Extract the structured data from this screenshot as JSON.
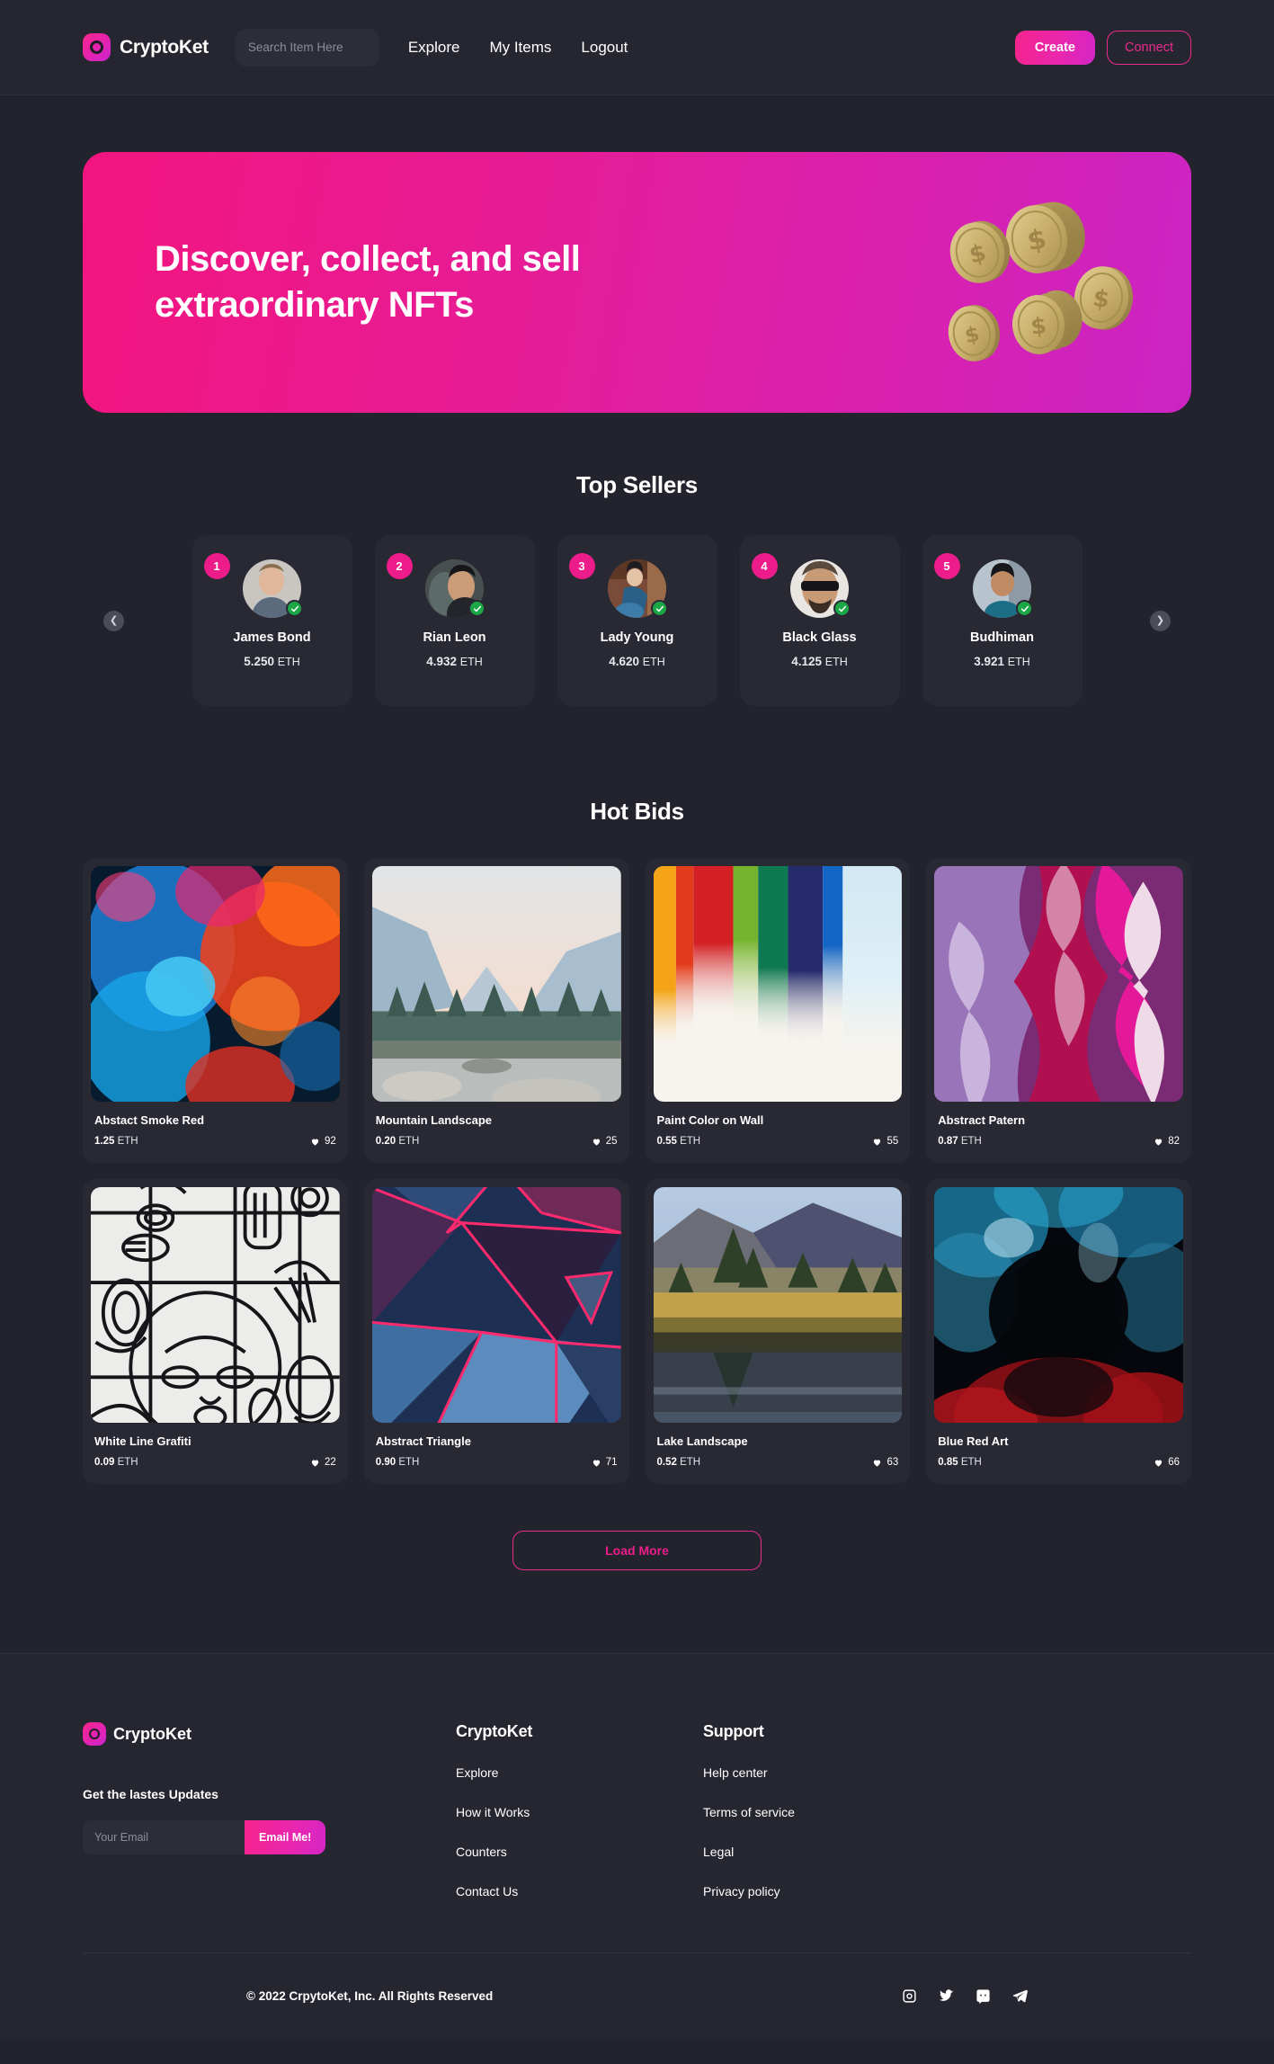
{
  "brand": {
    "name": "CryptoKet",
    "logo_icon": "cryptoket-logo-icon"
  },
  "navbar": {
    "search_placeholder": "Search Item Here",
    "search_value": "",
    "links": [
      {
        "label": "Explore"
      },
      {
        "label": "My Items"
      },
      {
        "label": "Logout"
      }
    ],
    "create_label": "Create",
    "connect_label": "Connect"
  },
  "hero": {
    "title": "Discover, collect, and sell extraordinary NFTs",
    "accent": "#ec1d8b",
    "illustration": "gold-coins-illustration"
  },
  "top_sellers": {
    "title": "Top Sellers",
    "prev_icon": "chevron-left-icon",
    "next_icon": "chevron-right-icon",
    "items": [
      {
        "rank": "1",
        "name": "James Bond",
        "price": "5.250",
        "currency": "ETH",
        "verified": true
      },
      {
        "rank": "2",
        "name": "Rian Leon",
        "price": "4.932",
        "currency": "ETH",
        "verified": true
      },
      {
        "rank": "3",
        "name": "Lady Young",
        "price": "4.620",
        "currency": "ETH",
        "verified": true
      },
      {
        "rank": "4",
        "name": "Black Glass",
        "price": "4.125",
        "currency": "ETH",
        "verified": true
      },
      {
        "rank": "5",
        "name": "Budhiman",
        "price": "3.921",
        "currency": "ETH",
        "verified": true
      }
    ]
  },
  "hot_bids": {
    "title": "Hot Bids",
    "load_more_label": "Load More",
    "items": [
      {
        "name": "Abstact Smoke Red",
        "price": "1.25",
        "currency": "ETH",
        "likes": "92"
      },
      {
        "name": "Mountain Landscape",
        "price": "0.20",
        "currency": "ETH",
        "likes": "25"
      },
      {
        "name": "Paint Color on Wall",
        "price": "0.55",
        "currency": "ETH",
        "likes": "55"
      },
      {
        "name": "Abstract Patern",
        "price": "0.87",
        "currency": "ETH",
        "likes": "82"
      },
      {
        "name": "White Line Grafiti",
        "price": "0.09",
        "currency": "ETH",
        "likes": "22"
      },
      {
        "name": "Abstract Triangle",
        "price": "0.90",
        "currency": "ETH",
        "likes": "71"
      },
      {
        "name": "Lake Landscape",
        "price": "0.52",
        "currency": "ETH",
        "likes": "63"
      },
      {
        "name": "Blue Red Art",
        "price": "0.85",
        "currency": "ETH",
        "likes": "66"
      }
    ]
  },
  "footer": {
    "brand_name": "CryptoKet",
    "newsletter_heading": "Get the lastes Updates",
    "email_placeholder": "Your Email",
    "email_value": "",
    "email_button_label": "Email Me!",
    "col_cryptoket": {
      "title": "CryptoKet",
      "links": [
        {
          "label": "Explore"
        },
        {
          "label": "How it Works"
        },
        {
          "label": "Counters"
        },
        {
          "label": "Contact Us"
        }
      ]
    },
    "col_support": {
      "title": "Support",
      "links": [
        {
          "label": "Help center"
        },
        {
          "label": "Terms of service"
        },
        {
          "label": "Legal"
        },
        {
          "label": "Privacy policy"
        }
      ]
    },
    "copyright": "© 2022 CrpytoKet, Inc. All Rights Reserved",
    "socials": [
      {
        "name": "instagram-icon"
      },
      {
        "name": "twitter-icon"
      },
      {
        "name": "discord-icon"
      },
      {
        "name": "telegram-icon"
      }
    ]
  }
}
